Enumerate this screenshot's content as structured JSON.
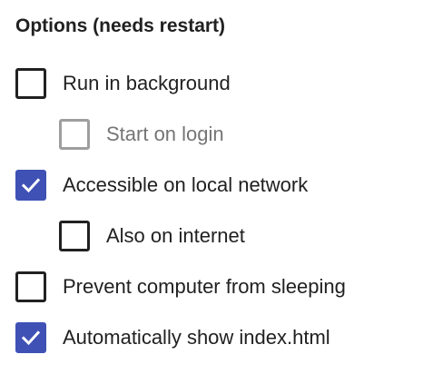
{
  "heading": "Options (needs restart)",
  "options": [
    {
      "label": "Run in background",
      "checked": false,
      "disabled": false
    },
    {
      "label": "Start on login",
      "checked": false,
      "disabled": true
    },
    {
      "label": "Accessible on local network",
      "checked": true,
      "disabled": false
    },
    {
      "label": "Also on internet",
      "checked": false,
      "disabled": false
    },
    {
      "label": "Prevent computer from sleeping",
      "checked": false,
      "disabled": false
    },
    {
      "label": "Automatically show index.html",
      "checked": true,
      "disabled": false
    }
  ],
  "colors": {
    "accent": "#3f51b5",
    "text": "#212121",
    "disabled": "#9e9e9e"
  },
  "icons": {
    "check": "check-icon"
  }
}
